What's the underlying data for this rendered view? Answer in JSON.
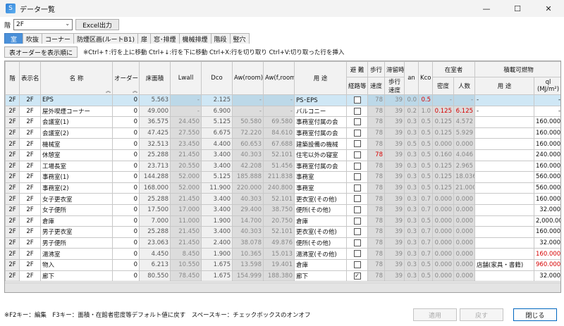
{
  "window": {
    "title": "データ一覧",
    "app_icon_glyph": "S",
    "controls": [
      "—",
      "☐",
      "✕"
    ]
  },
  "floor": {
    "label": "階",
    "selected": "2F",
    "excel_button": "Excel出力"
  },
  "tabs": [
    {
      "label": "室",
      "active": true
    },
    {
      "label": "吹抜",
      "active": false
    },
    {
      "label": "コーナー",
      "active": false
    },
    {
      "label": "防煙区画(ルートB1)",
      "active": false
    },
    {
      "label": "扉",
      "active": false
    },
    {
      "label": "窓･排煙",
      "active": false
    },
    {
      "label": "機械排煙",
      "active": false
    },
    {
      "label": "階段",
      "active": false
    },
    {
      "label": "竪穴",
      "active": false
    }
  ],
  "order": {
    "button": "表オーダーを表示順に",
    "hint": "※Ctrl+↑:行を上に移動  Ctrl+↓:行を下に移動  Ctrl+X:行を切り取り  Ctrl+V:切り取った行を挿入"
  },
  "columns": {
    "floor": "階",
    "display_name": "表示名",
    "name": "名 称",
    "order": "オーダー",
    "floor_area": "床面積",
    "lwall": "Lwall",
    "dco": "Dco",
    "aw_room": "Aw(room)",
    "aw_froom": "Aw(f,room)",
    "use": "用 途",
    "evac_top": "避 難",
    "evac_bottom": "経路等",
    "walk_speed_top": "歩行",
    "walk_speed_bottom": "速度",
    "stay_top": "滞留時",
    "stay_mid": "歩行",
    "stay_bottom": "速度",
    "an": "an",
    "kco": "Kco",
    "occupants_group": "在室者",
    "density": "密度",
    "people": "人数",
    "combustibles_group": "積載可燃物",
    "comb_use": "用 途",
    "ql_top": "ql",
    "ql_bottom": "(MJ/m²)"
  },
  "rows": [
    {
      "floor": "2F",
      "disp": "2F",
      "name": "EPS",
      "order": "0",
      "area": "5.563",
      "lwall": "-",
      "dco": "2.125",
      "aw": "-",
      "awf": "-",
      "use": "PS･EPS",
      "evac": false,
      "walk": "78",
      "stay": "39",
      "an": "0.0",
      "kco": "0.5",
      "density": "-",
      "people": "-",
      "comb": "-",
      "ql": "-"
    },
    {
      "floor": "2F",
      "disp": "2F",
      "name": "屋外喫煙コーナー",
      "order": "0",
      "area": "49.000",
      "lwall": "-",
      "dco": "6.900",
      "aw": "-",
      "awf": "-",
      "use": "バルコニー",
      "evac": false,
      "walk": "78",
      "stay": "39",
      "an": "0.2",
      "kco": "1.0",
      "density": "0.125",
      "people": "6.125",
      "comb": "-",
      "ql": "-"
    },
    {
      "floor": "2F",
      "disp": "2F",
      "name": "会議室(1)",
      "order": "0",
      "area": "36.575",
      "lwall": "24.450",
      "dco": "5.125",
      "aw": "50.580",
      "awf": "69.580",
      "use": "事務室付属の会",
      "evac": false,
      "walk": "78",
      "stay": "39",
      "an": "0.3",
      "kco": "0.5",
      "density": "0.125",
      "people": "4.572",
      "comb": "",
      "ql": "160.000"
    },
    {
      "floor": "2F",
      "disp": "2F",
      "name": "会議室(2)",
      "order": "0",
      "area": "47.425",
      "lwall": "27.550",
      "dco": "6.675",
      "aw": "72.220",
      "awf": "84.610",
      "use": "事務室付属の会",
      "evac": false,
      "walk": "78",
      "stay": "39",
      "an": "0.3",
      "kco": "0.5",
      "density": "0.125",
      "people": "5.929",
      "comb": "",
      "ql": "160.000"
    },
    {
      "floor": "2F",
      "disp": "2F",
      "name": "機械室",
      "order": "0",
      "area": "32.513",
      "lwall": "23.450",
      "dco": "4.400",
      "aw": "60.653",
      "awf": "67.688",
      "use": "建築設備の機械",
      "evac": false,
      "walk": "78",
      "stay": "39",
      "an": "0.5",
      "kco": "0.5",
      "density": "0.000",
      "people": "0.000",
      "comb": "",
      "ql": "160.000"
    },
    {
      "floor": "2F",
      "disp": "2F",
      "name": "休憩室",
      "order": "0",
      "area": "25.288",
      "lwall": "21.450",
      "dco": "3.400",
      "aw": "40.303",
      "awf": "52.101",
      "use": "住宅以外の寝室",
      "evac": false,
      "walk": "78",
      "stay": "39",
      "an": "0.3",
      "kco": "0.5",
      "density": "0.160",
      "people": "4.046",
      "comb": "",
      "ql": "240.000"
    },
    {
      "floor": "2F",
      "disp": "2F",
      "name": "工場長室",
      "order": "0",
      "area": "23.713",
      "lwall": "20.550",
      "dco": "3.400",
      "aw": "42.208",
      "awf": "51.456",
      "use": "事務室付属の会",
      "evac": false,
      "walk": "78",
      "stay": "39",
      "an": "0.3",
      "kco": "0.5",
      "density": "0.125",
      "people": "2.965",
      "comb": "",
      "ql": "160.000"
    },
    {
      "floor": "2F",
      "disp": "2F",
      "name": "事務室(1)",
      "order": "0",
      "area": "144.288",
      "lwall": "52.000",
      "dco": "5.125",
      "aw": "185.888",
      "awf": "211.838",
      "use": "事務室",
      "evac": false,
      "walk": "78",
      "stay": "39",
      "an": "0.3",
      "kco": "0.5",
      "density": "0.125",
      "people": "18.036",
      "comb": "",
      "ql": "560.000"
    },
    {
      "floor": "2F",
      "disp": "2F",
      "name": "事務室(2)",
      "order": "0",
      "area": "168.000",
      "lwall": "52.000",
      "dco": "11.900",
      "aw": "220.000",
      "awf": "240.800",
      "use": "事務室",
      "evac": false,
      "walk": "78",
      "stay": "39",
      "an": "0.3",
      "kco": "0.5",
      "density": "0.125",
      "people": "21.000",
      "comb": "",
      "ql": "560.000"
    },
    {
      "floor": "2F",
      "disp": "2F",
      "name": "女子更衣室",
      "order": "0",
      "area": "25.288",
      "lwall": "21.450",
      "dco": "3.400",
      "aw": "40.303",
      "awf": "52.101",
      "use": "更衣室(その他)",
      "evac": false,
      "walk": "78",
      "stay": "39",
      "an": "0.3",
      "kco": "0.7",
      "density": "0.000",
      "people": "0.000",
      "comb": "",
      "ql": "160.000"
    },
    {
      "floor": "2F",
      "disp": "2F",
      "name": "女子便所",
      "order": "0",
      "area": "17.500",
      "lwall": "17.000",
      "dco": "3.400",
      "aw": "29.400",
      "awf": "38.750",
      "use": "便所(その他)",
      "evac": false,
      "walk": "78",
      "stay": "39",
      "an": "0.3",
      "kco": "0.7",
      "density": "0.000",
      "people": "0.000",
      "comb": "",
      "ql": "32.000"
    },
    {
      "floor": "2F",
      "disp": "2F",
      "name": "倉庫",
      "order": "0",
      "area": "7.000",
      "lwall": "11.000",
      "dco": "1.900",
      "aw": "14.700",
      "awf": "20.750",
      "use": "倉庫",
      "evac": false,
      "walk": "78",
      "stay": "39",
      "an": "0.3",
      "kco": "0.5",
      "density": "0.000",
      "people": "0.000",
      "comb": "",
      "ql": "2,000.000"
    },
    {
      "floor": "2F",
      "disp": "2F",
      "name": "男子更衣室",
      "order": "0",
      "area": "25.288",
      "lwall": "21.450",
      "dco": "3.400",
      "aw": "40.303",
      "awf": "52.101",
      "use": "更衣室(その他)",
      "evac": false,
      "walk": "78",
      "stay": "39",
      "an": "0.3",
      "kco": "0.7",
      "density": "0.000",
      "people": "0.000",
      "comb": "",
      "ql": "160.000"
    },
    {
      "floor": "2F",
      "disp": "2F",
      "name": "男子便所",
      "order": "0",
      "area": "23.063",
      "lwall": "21.450",
      "dco": "2.400",
      "aw": "38.078",
      "awf": "49.876",
      "use": "便所(その他)",
      "evac": false,
      "walk": "78",
      "stay": "39",
      "an": "0.3",
      "kco": "0.7",
      "density": "0.000",
      "people": "0.000",
      "comb": "",
      "ql": "32.000"
    },
    {
      "floor": "2F",
      "disp": "2F",
      "name": "湯沸室",
      "order": "0",
      "area": "4.450",
      "lwall": "8.450",
      "dco": "1.900",
      "aw": "10.365",
      "awf": "15.013",
      "use": "湯沸室(その他)",
      "evac": false,
      "walk": "78",
      "stay": "39",
      "an": "0.3",
      "kco": "0.7",
      "density": "0.000",
      "people": "0.000",
      "comb": "",
      "ql": "160.000"
    },
    {
      "floor": "2F",
      "disp": "2F",
      "name": "物入",
      "order": "0",
      "area": "6.213",
      "lwall": "10.550",
      "dco": "1.675",
      "aw": "13.598",
      "awf": "19.401",
      "use": "倉庫",
      "evac": false,
      "walk": "78",
      "stay": "39",
      "an": "0.3",
      "kco": "0.5",
      "density": "0.000",
      "people": "0.000",
      "comb": "店舗(家具・書籍)",
      "ql": "960.000"
    },
    {
      "floor": "2F",
      "disp": "2F",
      "name": "廊下",
      "order": "0",
      "area": "80.550",
      "lwall": "78.450",
      "dco": "1.675",
      "aw": "154.999",
      "awf": "188.380",
      "use": "廊下",
      "evac": true,
      "walk": "78",
      "stay": "39",
      "an": "0.3",
      "kco": "0.5",
      "density": "0.000",
      "people": "0.000",
      "comb": "",
      "ql": "32.000"
    }
  ],
  "status": {
    "text": "※F2キー：編集　F3キー：面積・在館者密度等デフォルト値に戻す　スペースキー：チェックボックスのオンオフ"
  },
  "footer": {
    "apply": "適用",
    "revert": "戻す",
    "close": "閉じる"
  },
  "colors": {
    "tab_active": "#4a90d9",
    "selected_row": "#cfe7f5",
    "red_value": "#d60000"
  }
}
